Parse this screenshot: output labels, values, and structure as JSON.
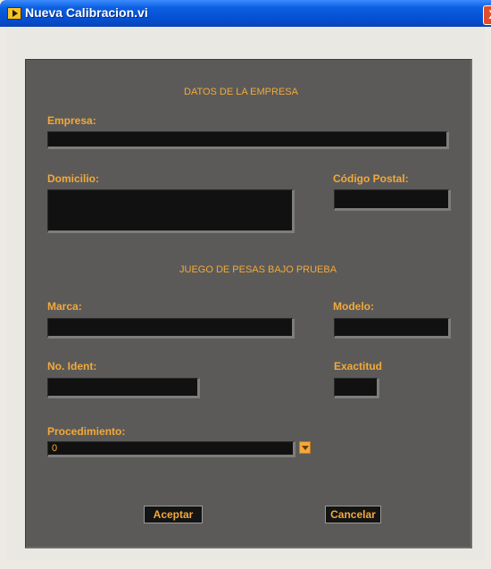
{
  "window": {
    "title": "Nueva Calibracion.vi",
    "close_glyph": "X"
  },
  "sections": {
    "empresa_title": "DATOS DE LA EMPRESA",
    "pesas_title": "JUEGO DE PESAS BAJO PRUEBA"
  },
  "fields": {
    "empresa": {
      "label": "Empresa:",
      "value": ""
    },
    "domicilio": {
      "label": "Domicilio:",
      "value": ""
    },
    "codigo_postal": {
      "label": "Código Postal:",
      "value": ""
    },
    "marca": {
      "label": "Marca:",
      "value": ""
    },
    "modelo": {
      "label": "Modelo:",
      "value": ""
    },
    "no_ident": {
      "label": "No. Ident:",
      "value": ""
    },
    "exactitud": {
      "label": "Exactitud",
      "value": ""
    },
    "procedimiento": {
      "label": "Procedimiento:",
      "value": "0"
    }
  },
  "buttons": {
    "accept": "Aceptar",
    "cancel": "Cancelar"
  },
  "icons": {
    "app": "labview-vi-icon",
    "close": "close-icon",
    "dropdown": "chevron-down-icon"
  },
  "colors": {
    "accent": "#f2a93b",
    "panel": "#5b5a58",
    "field": "#111111",
    "titlebar": "#0450d2"
  }
}
